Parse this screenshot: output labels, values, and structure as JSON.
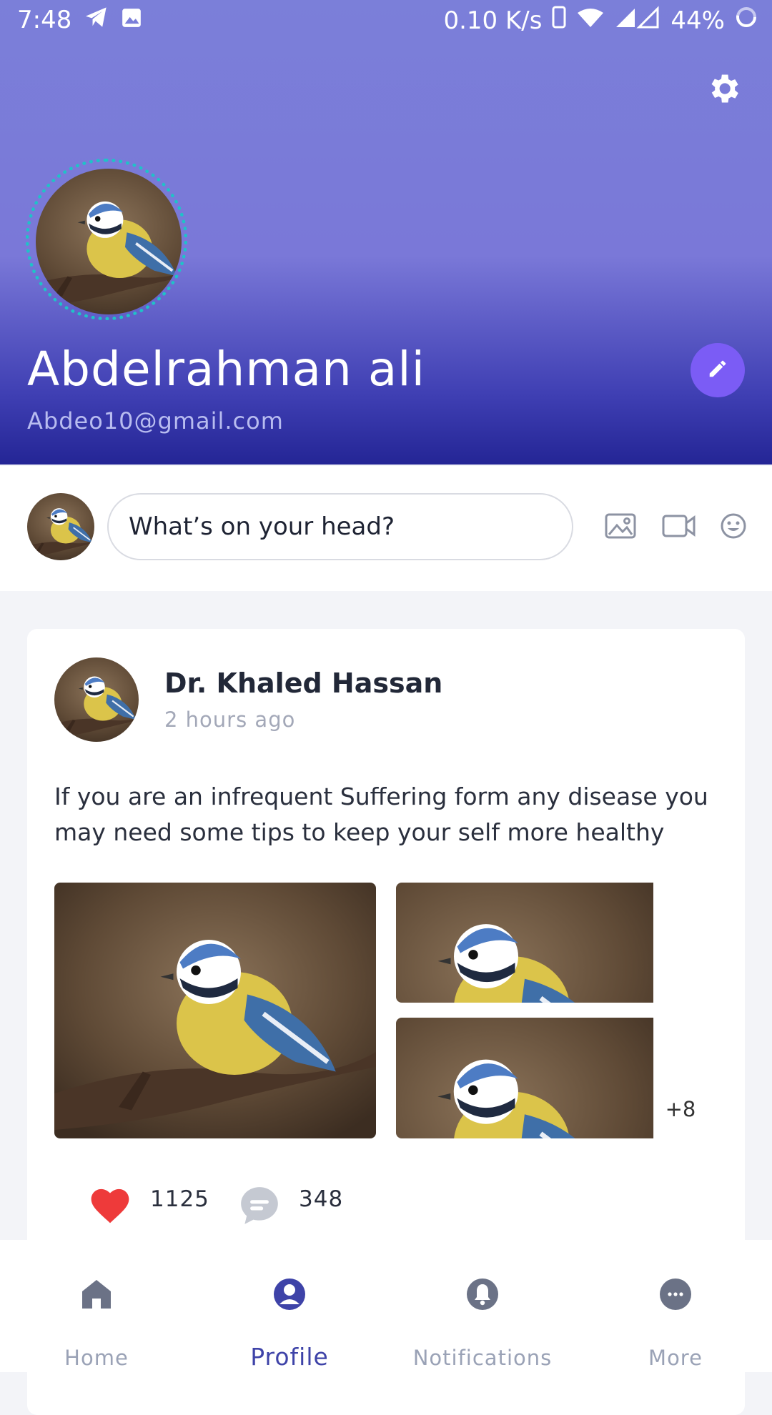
{
  "status_bar": {
    "time": "7:48",
    "network_speed": "0.10 K/s",
    "battery": "44%"
  },
  "header": {
    "name": "Abdelrahman ali",
    "email": "Abdeo10@gmail.com",
    "settings_icon": "gear-icon",
    "edit_icon": "pencil-icon",
    "accent_color": "#7b5cf5",
    "ring_color": "#1fc2c8"
  },
  "composer": {
    "placeholder": "What’s on your head?",
    "icons": [
      "image-icon",
      "video-icon",
      "emoji-icon"
    ]
  },
  "post": {
    "author": "Dr. Khaled Hassan",
    "time": "2 hours ago",
    "text": "If you are an infrequent Suffering form any disease you may need some tips to keep your self more healthy",
    "more_images": "+8",
    "likes": "1125",
    "comments": "348",
    "like_color": "#ee3a3a"
  },
  "nav": {
    "items": [
      {
        "label": "Home",
        "icon": "home-icon"
      },
      {
        "label": "Profile",
        "icon": "profile-icon",
        "active": true
      },
      {
        "label": "Notifications",
        "icon": "bell-icon"
      },
      {
        "label": "More",
        "icon": "more-icon"
      }
    ]
  }
}
